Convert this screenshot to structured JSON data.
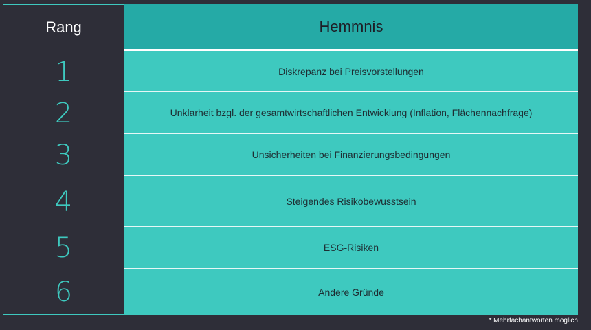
{
  "table": {
    "rank_header": "Rang",
    "obstacle_header": "Hemmnis",
    "rows": [
      {
        "rank": "1",
        "obstacle": "Diskrepanz bei Preisvorstellungen"
      },
      {
        "rank": "2",
        "obstacle": "Unklarheit bzgl. der gesamtwirtschaftlichen Entwicklung (Inflation, Flächennachfrage)"
      },
      {
        "rank": "3",
        "obstacle": "Unsicherheiten bei Finanzierungsbedingungen"
      },
      {
        "rank": "4",
        "obstacle": "Steigendes Risikobewusstsein"
      },
      {
        "rank": "5",
        "obstacle": "ESG-Risiken"
      },
      {
        "rank": "6",
        "obstacle": "Andere Gründe"
      }
    ]
  },
  "footnote": "* Mehrfachantworten möglich",
  "colors": {
    "background": "#2e2e38",
    "accent": "#3ec9bf",
    "header_teal": "#25aaa6"
  }
}
